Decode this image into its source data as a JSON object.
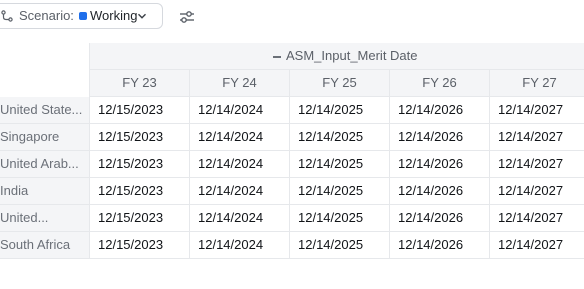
{
  "toolbar": {
    "scenario_label": "Scenario:",
    "scenario_value": "Working",
    "scenario_color": "#1f6feb",
    "icons": [
      "branch-icon",
      "chevron-down-icon",
      "sliders-icon"
    ]
  },
  "table": {
    "group_title": "ASM_Input_Merit Date",
    "columns": [
      "FY 23",
      "FY 24",
      "FY 25",
      "FY 26",
      "FY 27"
    ],
    "rows": [
      {
        "label": "United State...",
        "values": [
          "12/15/2023",
          "12/14/2024",
          "12/14/2025",
          "12/14/2026",
          "12/14/2027"
        ]
      },
      {
        "label": "Singapore",
        "values": [
          "12/15/2023",
          "12/14/2024",
          "12/14/2025",
          "12/14/2026",
          "12/14/2027"
        ]
      },
      {
        "label": "United Arab...",
        "values": [
          "12/15/2023",
          "12/14/2024",
          "12/14/2025",
          "12/14/2026",
          "12/14/2027"
        ]
      },
      {
        "label": "India",
        "values": [
          "12/15/2023",
          "12/14/2024",
          "12/14/2025",
          "12/14/2026",
          "12/14/2027"
        ]
      },
      {
        "label": "United...",
        "values": [
          "12/15/2023",
          "12/14/2024",
          "12/14/2025",
          "12/14/2026",
          "12/14/2027"
        ]
      },
      {
        "label": "South Africa",
        "values": [
          "12/15/2023",
          "12/14/2024",
          "12/14/2025",
          "12/14/2026",
          "12/14/2027"
        ]
      }
    ]
  }
}
